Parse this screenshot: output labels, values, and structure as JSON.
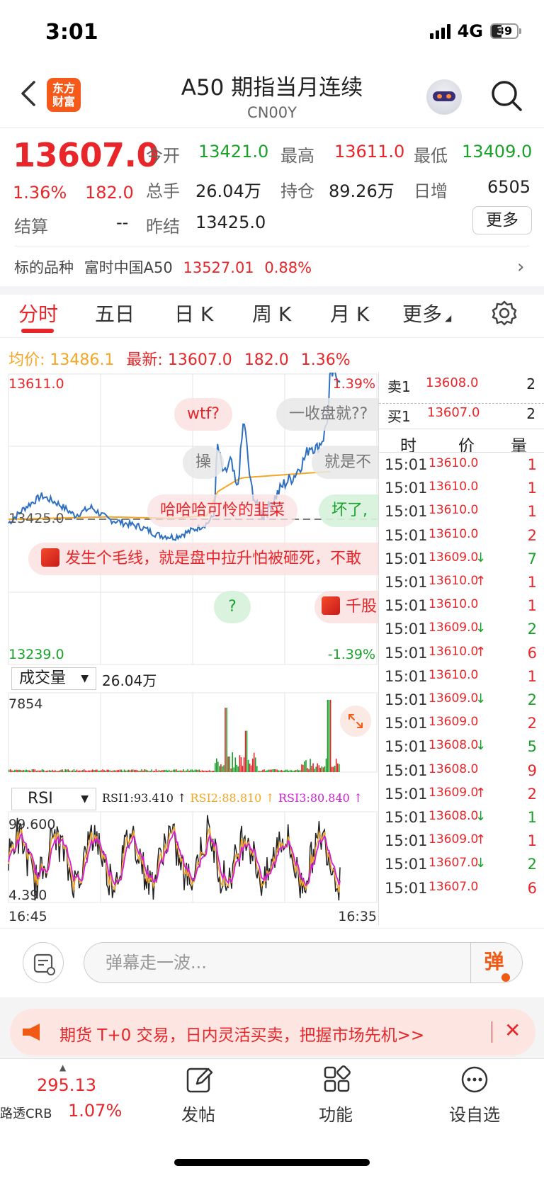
{
  "status_bar": {
    "time": "3:01",
    "network": "4G",
    "battery": "39"
  },
  "header": {
    "title": "A50 期指当月连续",
    "code": "CN00Y",
    "logo_text": "东方\n财富"
  },
  "quote": {
    "price": "13607.0",
    "change_pct": "1.36%",
    "change": "182.0",
    "open_label": "今开",
    "open": "13421.0",
    "high_label": "最高",
    "high": "13611.0",
    "low_label": "最低",
    "low": "13409.0",
    "volume_label": "总手",
    "volume": "26.04万",
    "oi_label": "持仓",
    "oi": "89.26万",
    "daily_inc_label": "日增",
    "daily_inc": "6505",
    "settle_label": "结算",
    "settle": "--",
    "prev_settle_label": "昨结",
    "prev_settle": "13425.0",
    "more_label": "更多"
  },
  "underlying": {
    "label": "标的品种",
    "name": "富时中国A50",
    "price": "13527.01",
    "pct": "0.88%"
  },
  "tabs": [
    {
      "label": "分时",
      "active": true
    },
    {
      "label": "五日"
    },
    {
      "label": "日 K"
    },
    {
      "label": "周 K"
    },
    {
      "label": "月 K"
    },
    {
      "label": "更多"
    }
  ],
  "stats_line": {
    "avg_label": "均价:",
    "avg": "13486.1",
    "latest_label": "最新:",
    "latest": "13607.0",
    "chg": "182.0",
    "pct": "1.36%"
  },
  "chart_data": [
    {
      "type": "line",
      "name": "intraday",
      "ylim": [
        13239.0,
        13611.0
      ],
      "y_top_label": "13611.0",
      "y_bottom_label": "13239.0",
      "pct_top_label": "1.39%",
      "pct_bottom_label": "-1.39%",
      "reference_label": "13425.0",
      "reference": 13425.0,
      "price_anchors": [
        [
          0,
          13420
        ],
        [
          0.05,
          13440
        ],
        [
          0.1,
          13455
        ],
        [
          0.15,
          13445
        ],
        [
          0.2,
          13430
        ],
        [
          0.25,
          13440
        ],
        [
          0.3,
          13425
        ],
        [
          0.35,
          13420
        ],
        [
          0.4,
          13415
        ],
        [
          0.45,
          13405
        ],
        [
          0.5,
          13402
        ],
        [
          0.55,
          13410
        ],
        [
          0.6,
          13420
        ],
        [
          0.62,
          13430
        ],
        [
          0.63,
          13520
        ],
        [
          0.65,
          13480
        ],
        [
          0.67,
          13500
        ],
        [
          0.69,
          13460
        ],
        [
          0.71,
          13555
        ],
        [
          0.73,
          13470
        ],
        [
          0.75,
          13440
        ],
        [
          0.77,
          13430
        ],
        [
          0.8,
          13450
        ],
        [
          0.83,
          13470
        ],
        [
          0.86,
          13480
        ],
        [
          0.89,
          13500
        ],
        [
          0.91,
          13520
        ],
        [
          0.93,
          13515
        ],
        [
          0.95,
          13530
        ],
        [
          0.965,
          13560
        ],
        [
          0.97,
          13611
        ],
        [
          1.0,
          13607
        ]
      ],
      "avg_anchors": [
        [
          0,
          13425
        ],
        [
          0.3,
          13428
        ],
        [
          0.5,
          13426
        ],
        [
          0.6,
          13430
        ],
        [
          0.63,
          13460
        ],
        [
          0.7,
          13478
        ],
        [
          0.8,
          13481
        ],
        [
          0.9,
          13484
        ],
        [
          0.97,
          13486
        ]
      ]
    },
    {
      "type": "bar",
      "name": "volume",
      "ylim": [
        0,
        7854
      ],
      "y_top_label": "7854",
      "select_label": "成交量",
      "total": "26.04万"
    },
    {
      "type": "line",
      "name": "RSI",
      "ylim": [
        4.39,
        99.6
      ],
      "y_top_label": "99.600",
      "y_bottom_label": "4.390",
      "x_labels": [
        "16:45",
        "16:35"
      ],
      "select_label": "RSI",
      "series": [
        {
          "name": "RSI1",
          "value": "93.410",
          "color": "#222222"
        },
        {
          "name": "RSI2",
          "value": "88.810",
          "color": "#f5a623"
        },
        {
          "name": "RSI3",
          "value": "80.840",
          "color": "#d21fd4"
        }
      ],
      "legend": [
        "RSI1:93.410",
        "RSI2:88.810",
        "RSI3:80.840"
      ]
    }
  ],
  "danmaku": [
    "wtf?",
    "一收盘就??",
    "操",
    "就是不",
    "哈哈哈可怜的韭菜",
    "坏了,",
    "发生个毛线，就是盘中拉升怕被砸死，不敢",
    "?",
    "千股"
  ],
  "order_book": {
    "sell1_label": "卖1",
    "sell1_price": "13608.0",
    "sell1_qty": "2",
    "buy1_label": "买1",
    "buy1_price": "13607.0",
    "buy1_qty": "2",
    "head_time": "时",
    "head_price": "价",
    "head_qty": "量",
    "ticks": [
      {
        "time": "15:01",
        "price": "13610.0",
        "qty": "1",
        "arrow": ""
      },
      {
        "time": "15:01",
        "price": "13610.0",
        "qty": "1",
        "arrow": ""
      },
      {
        "time": "15:01",
        "price": "13610.0",
        "qty": "1",
        "arrow": ""
      },
      {
        "time": "15:01",
        "price": "13610.0",
        "qty": "2",
        "arrow": ""
      },
      {
        "time": "15:01",
        "price": "13609.0",
        "qty": "7",
        "arrow": "↓"
      },
      {
        "time": "15:01",
        "price": "13610.0",
        "qty": "1",
        "arrow": "↑"
      },
      {
        "time": "15:01",
        "price": "13610.0",
        "qty": "1",
        "arrow": ""
      },
      {
        "time": "15:01",
        "price": "13609.0",
        "qty": "2",
        "arrow": "↓"
      },
      {
        "time": "15:01",
        "price": "13610.0",
        "qty": "6",
        "arrow": "↑"
      },
      {
        "time": "15:01",
        "price": "13610.0",
        "qty": "1",
        "arrow": ""
      },
      {
        "time": "15:01",
        "price": "13609.0",
        "qty": "2",
        "arrow": "↓"
      },
      {
        "time": "15:01",
        "price": "13609.0",
        "qty": "2",
        "arrow": ""
      },
      {
        "time": "15:01",
        "price": "13608.0",
        "qty": "5",
        "arrow": "↓"
      },
      {
        "time": "15:01",
        "price": "13608.0",
        "qty": "9",
        "arrow": ""
      },
      {
        "time": "15:01",
        "price": "13609.0",
        "qty": "2",
        "arrow": "↑"
      },
      {
        "time": "15:01",
        "price": "13608.0",
        "qty": "1",
        "arrow": "↓"
      },
      {
        "time": "15:01",
        "price": "13609.0",
        "qty": "1",
        "arrow": "↑"
      },
      {
        "time": "15:01",
        "price": "13607.0",
        "qty": "2",
        "arrow": "↓"
      },
      {
        "time": "15:01",
        "price": "13607.0",
        "qty": "6",
        "arrow": ""
      }
    ]
  },
  "comment": {
    "placeholder": "弹幕走一波...",
    "toggle": "弹"
  },
  "promo": {
    "text": "期货 T+0 交易，日内灵活买卖，把握市场先机>>"
  },
  "bottom_nav": {
    "index_value": "295.13",
    "index_name": "路透CRB",
    "index_pct": "1.07%",
    "post_label": "发帖",
    "func_label": "功能",
    "watch_label": "设自选"
  },
  "colors": {
    "up": "#e8262a",
    "down": "#1aa12b",
    "price_line": "#2f6fc0",
    "avg_line": "#f5a623",
    "accent": "#f55a1b"
  }
}
